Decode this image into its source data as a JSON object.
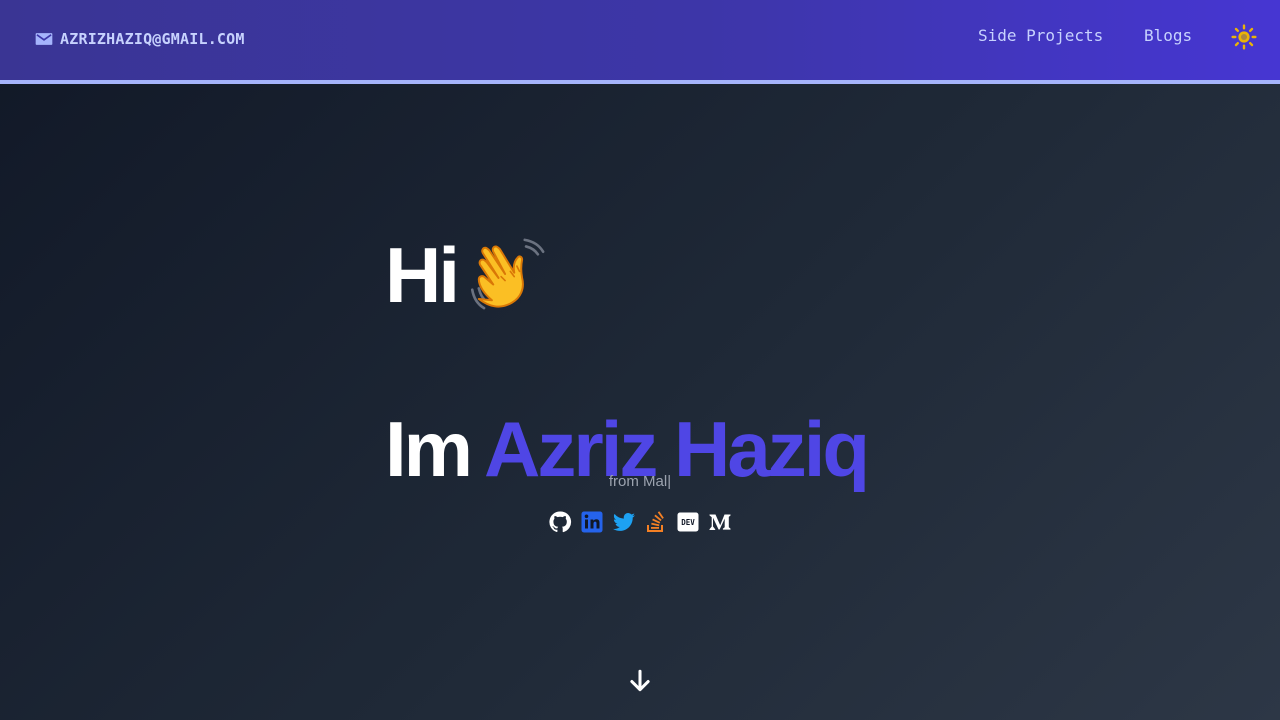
{
  "header": {
    "email": "AZRIZHAZIQ@GMAIL.COM",
    "email_icon": "mail-icon",
    "nav": [
      {
        "label": "Side Projects"
      },
      {
        "label": "Blogs"
      }
    ],
    "theme_icon": "sun-icon"
  },
  "hero": {
    "greeting": "Hi",
    "greeting_icon": "waving-hand-icon",
    "intro_prefix": "Im",
    "name": "Azriz Haziq",
    "subtitle": "from Mal",
    "cursor": "|"
  },
  "socials": [
    {
      "icon": "github-icon"
    },
    {
      "icon": "linkedin-icon"
    },
    {
      "icon": "twitter-icon"
    },
    {
      "icon": "stackoverflow-icon"
    },
    {
      "icon": "devto-icon"
    },
    {
      "icon": "medium-icon"
    }
  ],
  "scroll_icon": "arrow-down-icon",
  "colors": {
    "accent": "#4f46e5",
    "header_bg": "#3d36a8",
    "header_text": "#c7d2fe",
    "header_border": "#a5b4fc",
    "page_bg": "#1f2937",
    "subtitle": "#9ca3af"
  }
}
